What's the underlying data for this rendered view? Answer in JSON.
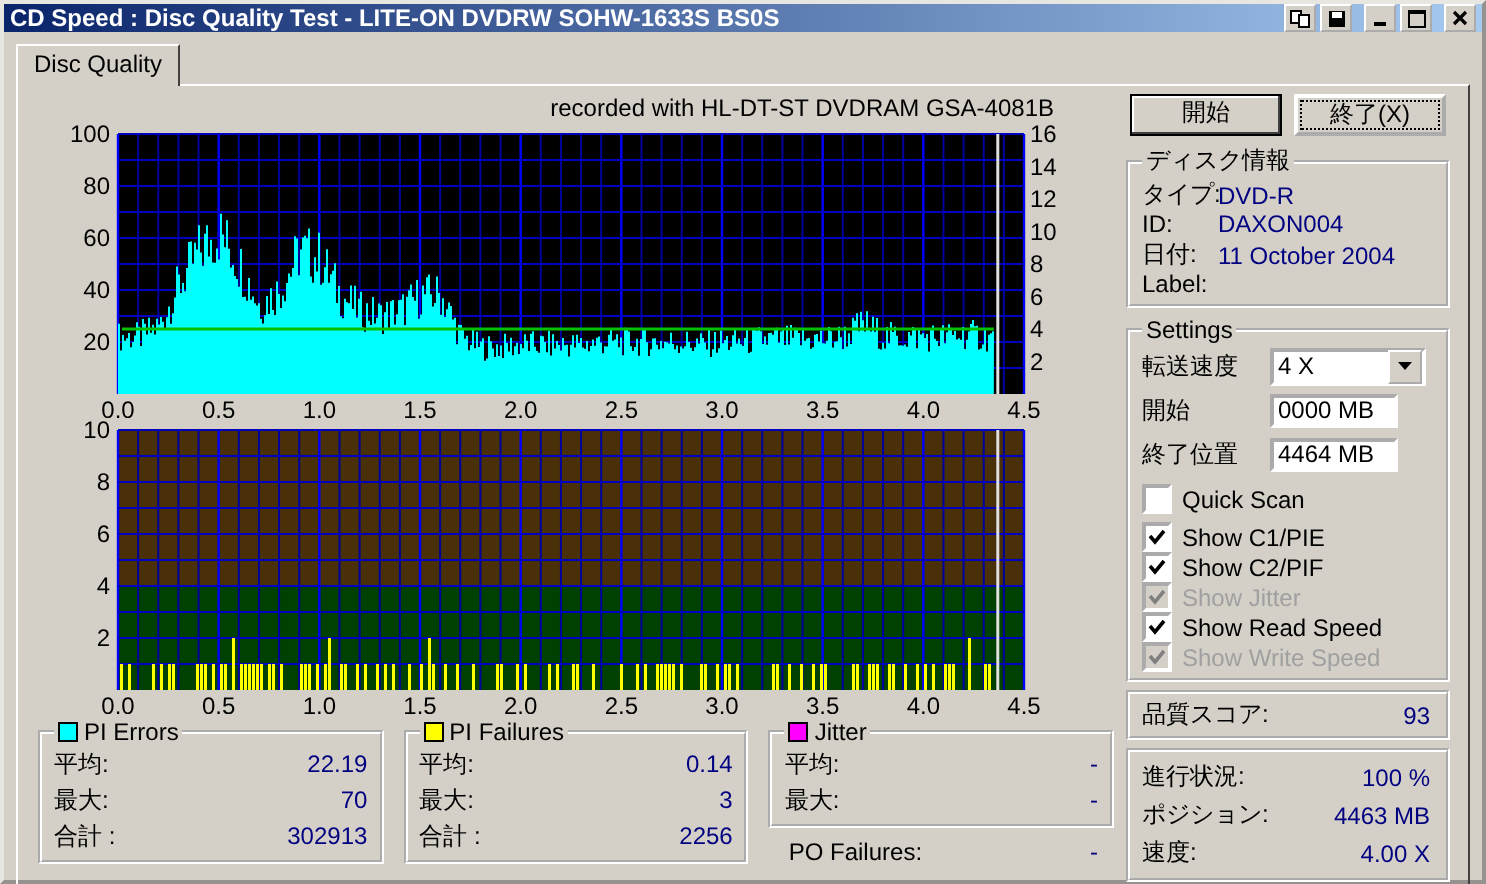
{
  "window": {
    "title": "CD Speed : Disc Quality Test - LITE-ON DVDRW SOHW-1633S BS0S"
  },
  "tabs": [
    {
      "label": "Disc Quality",
      "selected": true
    }
  ],
  "recorded_with": "recorded with HL-DT-ST DVDRAM GSA-4081B",
  "charts": [
    {
      "kind": "errors",
      "left_axis": [
        "100",
        "80",
        "60",
        "40",
        "20"
      ],
      "right_axis": [
        "16",
        "14",
        "12",
        "10",
        "8",
        "6",
        "4",
        "2"
      ],
      "bottom_axis": [
        "0.0",
        "0.5",
        "1.0",
        "1.5",
        "2.0",
        "2.5",
        "3.0",
        "3.5",
        "4.0",
        "4.5"
      ]
    },
    {
      "kind": "failures",
      "left_axis": [
        "10",
        "8",
        "6",
        "4",
        "2"
      ],
      "bottom_axis": [
        "0.0",
        "0.5",
        "1.0",
        "1.5",
        "2.0",
        "2.5",
        "3.0",
        "3.5",
        "4.0",
        "4.5"
      ]
    }
  ],
  "stats": [
    {
      "title": "PI Errors",
      "color": "#00ffff",
      "rows": [
        {
          "label": "平均:",
          "value": "22.19"
        },
        {
          "label": "最大:",
          "value": "70"
        },
        {
          "label": "合計 :",
          "value": "302913"
        }
      ]
    },
    {
      "title": "PI Failures",
      "color": "#ffff00",
      "rows": [
        {
          "label": "平均:",
          "value": "0.14"
        },
        {
          "label": "最大:",
          "value": "3"
        },
        {
          "label": "合計 :",
          "value": "2256"
        }
      ]
    },
    {
      "title": "Jitter",
      "color": "#ff00ff",
      "rows": [
        {
          "label": "平均:",
          "value": "-"
        },
        {
          "label": "最大:",
          "value": "-"
        }
      ]
    }
  ],
  "po_failures": {
    "label": "PO Failures:",
    "value": "-"
  },
  "buttons": [
    {
      "label": "開始",
      "focused": false
    },
    {
      "label": "終了(X)",
      "focused": true
    }
  ],
  "disc_info": {
    "title": "ディスク情報",
    "rows": [
      {
        "label": "タイプ:",
        "value": "DVD-R"
      },
      {
        "label": "ID:",
        "value": "DAXON004"
      },
      {
        "label": "日付:",
        "value": "11 October 2004"
      },
      {
        "label": "Label:"
      }
    ]
  },
  "settings": {
    "title": "Settings",
    "fields": [
      {
        "kind": "select",
        "label": "転送速度",
        "value": "4 X"
      },
      {
        "kind": "input",
        "label": "開始",
        "value": "0000 MB"
      },
      {
        "kind": "input",
        "label": "終了位置",
        "value": "4464 MB"
      }
    ],
    "options": [
      {
        "label": "Quick Scan",
        "checked": false,
        "disabled": false
      },
      {
        "label": "Show C1/PIE",
        "checked": true,
        "disabled": false
      },
      {
        "label": "Show C2/PIF",
        "checked": true,
        "disabled": false
      },
      {
        "label": "Show Jitter",
        "checked": true,
        "disabled": true
      },
      {
        "label": "Show Read Speed",
        "checked": true,
        "disabled": false
      },
      {
        "label": "Show Write Speed",
        "checked": true,
        "disabled": true
      }
    ]
  },
  "quality_score": {
    "label": "品質スコア:",
    "value": "93"
  },
  "progress": [
    {
      "label": "進行状況:",
      "value": "100 %"
    },
    {
      "label": "ポジション:",
      "value": "4463 MB"
    },
    {
      "label": "速度:",
      "value": "4.00 X"
    }
  ]
}
